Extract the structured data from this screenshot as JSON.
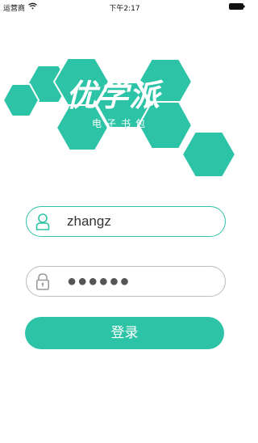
{
  "status_bar": {
    "carrier": "运营商",
    "time": "下午2:17"
  },
  "logo": {
    "title": "优学派",
    "subtitle": "电子书包"
  },
  "colors": {
    "accent": "#2dc3a6",
    "field_border_inactive": "#bdbdbd",
    "text": "#333333"
  },
  "login_form": {
    "username_value": "zhangz",
    "password_value": "●●●●●●",
    "submit_label": "登录",
    "username_icon": "user-icon",
    "password_icon": "lock-icon"
  }
}
